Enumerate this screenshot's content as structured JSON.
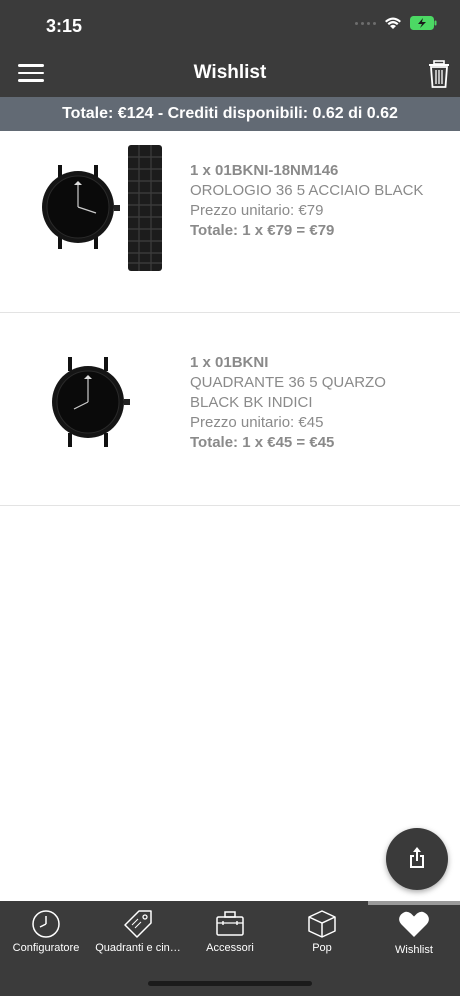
{
  "status_bar": {
    "time": "3:15"
  },
  "header": {
    "title": "Wishlist"
  },
  "summary": {
    "text": "Totale: €124 - Crediti disponibili: 0.62 di 0.62"
  },
  "items": [
    {
      "code": "1 x 01BKNI-18NM146",
      "name_line1": "OROLOGIO 36 5 ACCIAIO BLACK",
      "unit_price": "Prezzo unitario: €79",
      "total": "Totale: 1 x €79 = €79"
    },
    {
      "code": "1 x 01BKNI",
      "name_line1": "QUADRANTE 36 5 QUARZO",
      "name_line2": "BLACK BK INDICI",
      "unit_price": "Prezzo unitario: €45",
      "total": "Totale: 1 x €45 = €45"
    }
  ],
  "tabs": [
    {
      "label": "Configuratore",
      "icon": "clock-icon"
    },
    {
      "label": "Quadranti e cin…",
      "icon": "tag-icon"
    },
    {
      "label": "Accessori",
      "icon": "briefcase-icon"
    },
    {
      "label": "Pop",
      "icon": "box-icon"
    },
    {
      "label": "Wishlist",
      "icon": "heart-icon",
      "active": true
    }
  ]
}
